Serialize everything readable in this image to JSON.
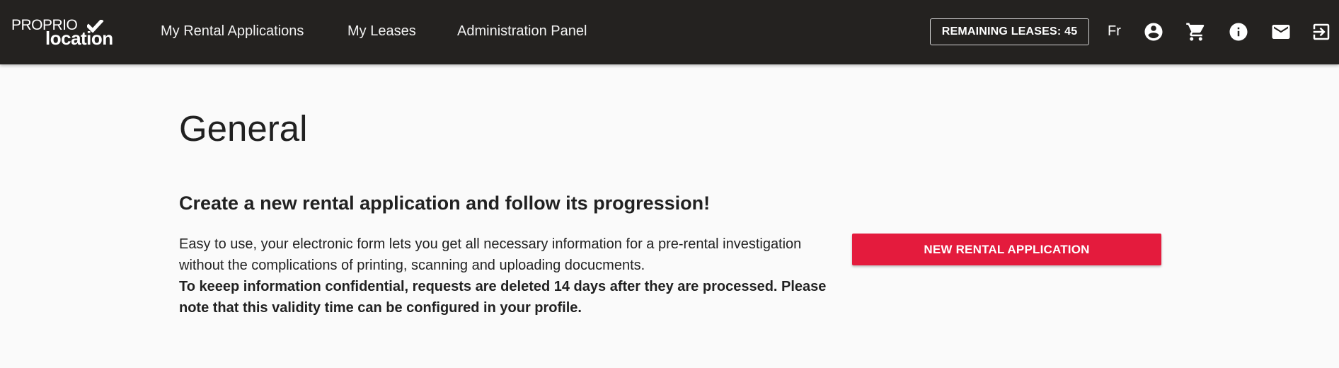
{
  "brand": {
    "line1": "PROPRIO",
    "line2": "location"
  },
  "nav": {
    "items": [
      {
        "label": "My Rental Applications"
      },
      {
        "label": "My Leases"
      },
      {
        "label": "Administration Panel"
      }
    ]
  },
  "header": {
    "remaining_leases": "REMAINING LEASES: 45",
    "language": "Fr",
    "icons": [
      "account-circle-icon",
      "cart-icon",
      "info-icon",
      "mail-icon",
      "logout-icon"
    ]
  },
  "main": {
    "title": "General",
    "heading": "Create a new rental application and follow its progression!",
    "description": "Easy to use, your electronic form lets you get all necessary information for a pre-rental investigation without the complications of printing, scanning and uploading docucments.",
    "notice": "To keeep information confidential, requests are deleted 14 days after they are processed. Please note that this validity time can be configured in your profile.",
    "cta_label": "NEW RENTAL APPLICATION"
  },
  "colors": {
    "header_bg": "#242220",
    "accent": "#e41b3d",
    "page_bg": "#fafafa"
  }
}
